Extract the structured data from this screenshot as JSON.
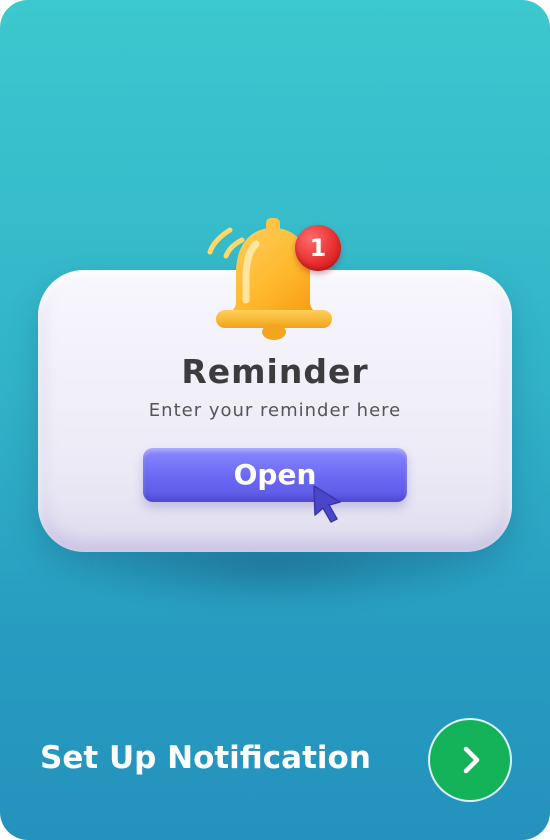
{
  "reminder_card": {
    "title": "Reminder",
    "subtitle": "Enter your reminder here",
    "button_label": "Open",
    "notification_count": "1"
  },
  "footer": {
    "label": "Set Up Notification",
    "next_icon": "chevron-right-icon"
  },
  "colors": {
    "background_top": "#3cc8cf",
    "background_bottom": "#2492bd",
    "card": "#eceaf6",
    "button": "#6a68f2",
    "bell": "#ffc23a",
    "badge": "#e52b2b",
    "next_button": "#14b35a"
  }
}
